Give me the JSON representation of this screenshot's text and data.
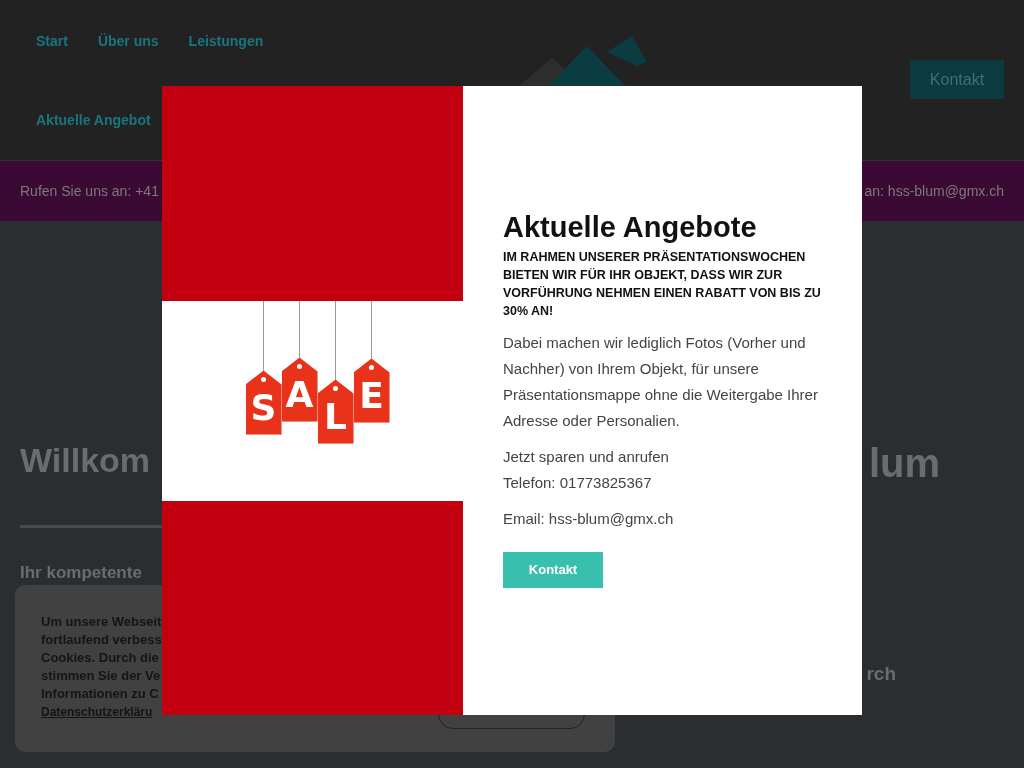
{
  "header": {
    "nav": [
      {
        "label": "Start"
      },
      {
        "label": "Über uns"
      },
      {
        "label": "Leistungen"
      }
    ],
    "nav_row_2": [
      {
        "label": "Aktuelle Angebot"
      }
    ],
    "contact_button": "Kontakt"
  },
  "info_bar": {
    "left": "Rufen Sie uns an: +41",
    "right": "an: hss-blum@gmx.ch"
  },
  "hero": {
    "headline_left": "Willkom",
    "headline_right": "lum",
    "subtitle": "Ihr kompetente",
    "text_right": "rch"
  },
  "cookie_notice": {
    "text": "Um unsere Webseit\nfortlaufend verbess\nCookies. Durch die\nstimmen Sie der Ve\nInformationen zu C",
    "link": "Datenschutzerkläru"
  },
  "modal": {
    "title": "Aktuelle Angebote",
    "lead": "IM RAHMEN UNSERER PRÄSENTATIONSWOCHEN BIETEN WIR FÜR IHR OBJEKT, DASS WIR ZUR VORFÜHRUNG NEHMEN EINEN RABATT VON BIS ZU 30% AN!",
    "paragraphs": [
      "Dabei machen wir lediglich Fotos (Vorher und Nachher) von Ihrem Objekt, für unsere Präsentationsmappe ohne die Weitergabe Ihrer Adresse oder Personalien.",
      "Jetzt sparen und anrufen\nTelefon: 01773825367",
      "Email: hss-blum@gmx.ch"
    ],
    "button": "Kontakt",
    "sale_tags": [
      "S",
      "A",
      "L",
      "E"
    ]
  }
}
